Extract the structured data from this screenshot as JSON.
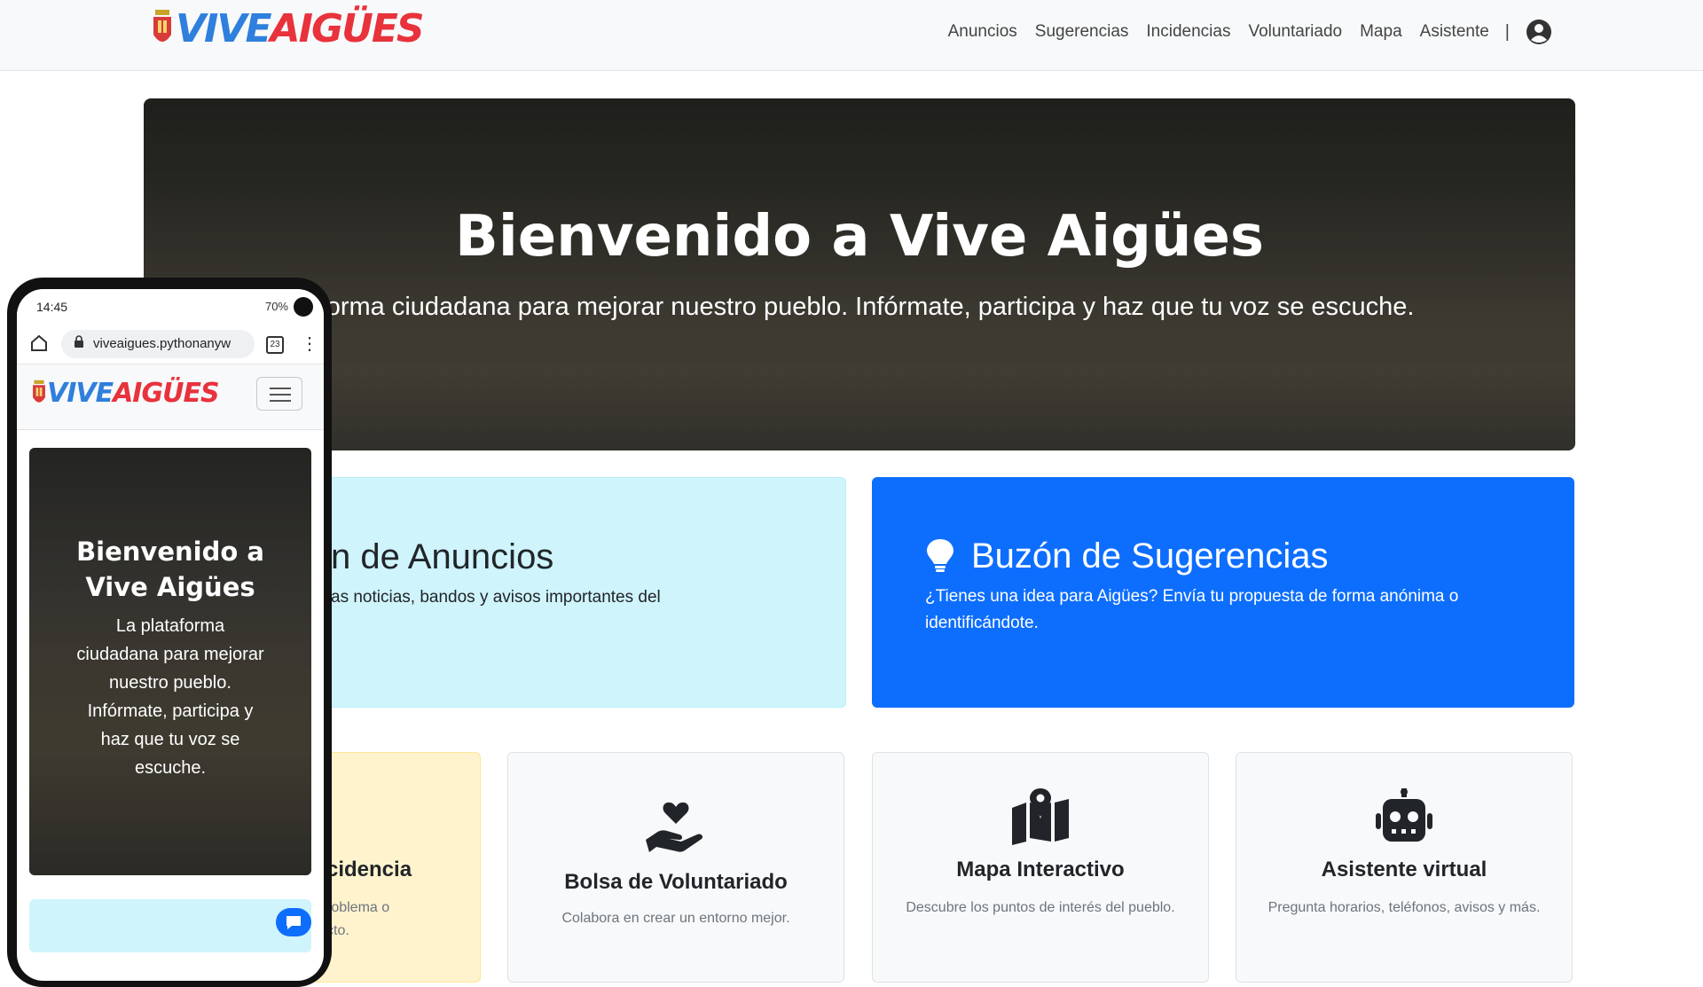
{
  "brand": {
    "logo_text_part1": "VIVE",
    "logo_text_part2": "AIGÜES"
  },
  "nav": {
    "items": [
      "Anuncios",
      "Sugerencias",
      "Incidencias",
      "Voluntariado",
      "Mapa",
      "Asistente"
    ],
    "separator": "|"
  },
  "hero": {
    "title": "Bienvenido a Vive Aigües",
    "subtitle_visible": "aforma ciudadana para mejorar nuestro pueblo. Infórmate, participa y haz que tu voz se escuche."
  },
  "cards": {
    "anuncios": {
      "title_visible": "n de Anuncios",
      "desc_visible": "as noticias, bandos y avisos importantes del"
    },
    "sugerencias": {
      "title": "Buzón de Sugerencias",
      "desc": "¿Tienes una idea para Aigües? Envía tu propuesta de forma anónima o identificándote.",
      "icon": "lightbulb-icon"
    },
    "incidencia": {
      "title_visible": "cidencia",
      "desc_line1_visible": "roblema o",
      "desc_line2_visible": "cto."
    },
    "voluntariado": {
      "title": "Bolsa de Voluntariado",
      "desc": "Colabora en crear un entorno mejor.",
      "icon": "hand-heart-icon"
    },
    "mapa": {
      "title": "Mapa Interactivo",
      "desc": "Descubre los puntos de interés del pueblo.",
      "icon": "map-location-icon"
    },
    "asistente": {
      "title": "Asistente virtual",
      "desc": "Pregunta horarios, teléfonos, avisos y más.",
      "icon": "robot-icon"
    }
  },
  "phone": {
    "status_time": "14:45",
    "status_battery": "70%",
    "url": "viveaigues.pythonanyw",
    "tabs_count": "23",
    "hero_title": "Bienvenido a Vive Aigües",
    "hero_subtitle": "La plataforma ciudadana para mejorar nuestro pueblo. Infórmate, participa y haz que tu voz se escuche."
  },
  "colors": {
    "primary": "#0d6efd",
    "info_light": "#cff4fc",
    "warning_light": "#fff3cd",
    "navbar_bg": "#f8f9fa",
    "logo_blue": "#2f7fdc",
    "logo_red": "#e8323c"
  }
}
